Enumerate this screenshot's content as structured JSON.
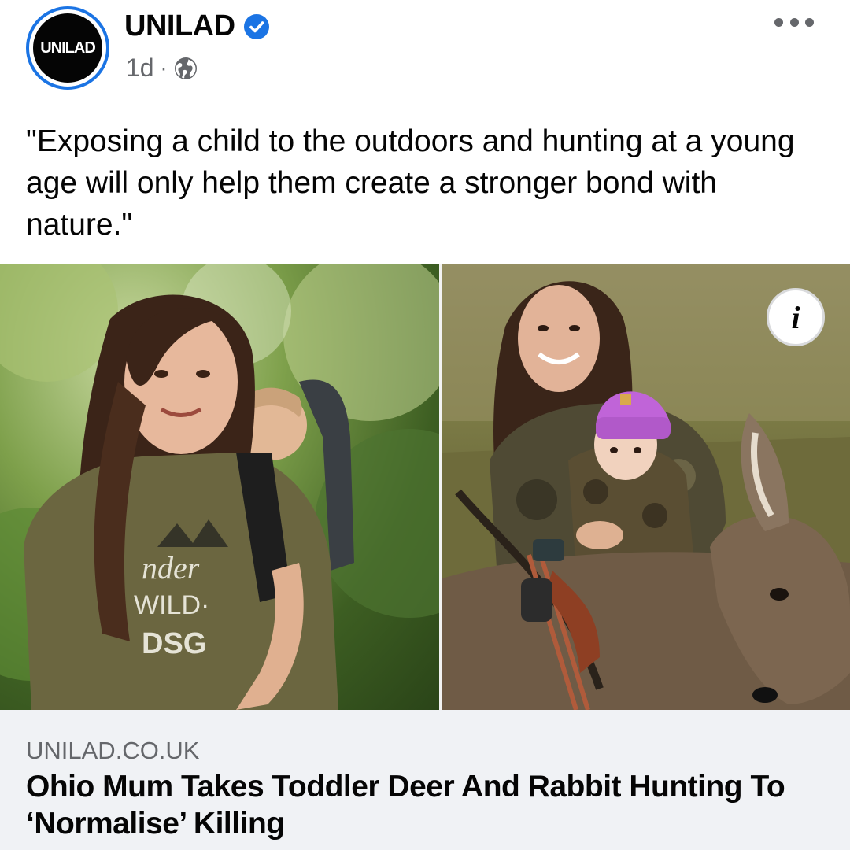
{
  "post": {
    "page_name": "UNILAD",
    "avatar_label": "UNILAD",
    "verified_icon": "verified-badge-icon",
    "timestamp": "1d",
    "separator": "·",
    "audience_icon": "globe-icon",
    "more_icon": "more-options-icon",
    "text": "\"Exposing a child to the outdoors and hunting at a young age will only help them create a stronger bond with nature.\""
  },
  "media": {
    "info_icon": "info-icon",
    "info_glyph": "i",
    "left_shirt_text": [
      "nder",
      "WILD·",
      "DSG"
    ]
  },
  "link_preview": {
    "domain": "UNILAD.CO.UK",
    "title": "Ohio Mum Takes Toddler Deer And Rabbit Hunting To ‘Normalise’ Killing"
  },
  "colors": {
    "accent": "#1b74e4",
    "text_primary": "#050505",
    "text_secondary": "#65676b",
    "preview_bg": "#f0f2f5",
    "hat_pink": "#c064d8"
  }
}
